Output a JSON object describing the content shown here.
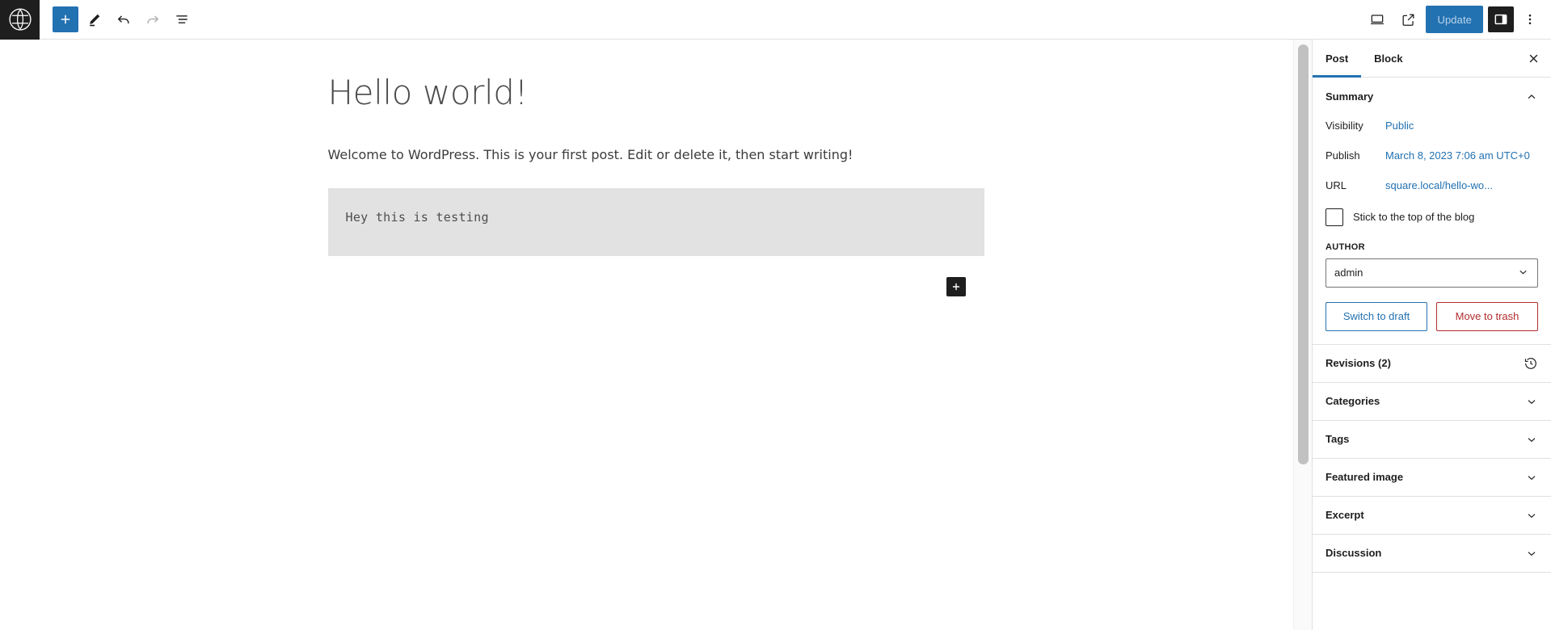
{
  "toolbar": {
    "logo_icon": "wordpress-logo-icon",
    "add_block_label": "+",
    "add_block_icon": "plus-icon",
    "tools_icon": "pencil-icon",
    "undo_icon": "undo-icon",
    "redo_icon": "redo-icon",
    "list_view_icon": "list-view-icon",
    "preview_icon": "desktop-preview-icon",
    "view_post_icon": "external-link-icon",
    "update_label": "Update",
    "settings_icon": "settings-sidebar-icon",
    "options_icon": "three-dots-vertical-icon",
    "accent_color": "#2271b1",
    "dark_color": "#1e1e1e"
  },
  "editor": {
    "title": "Hello world!",
    "paragraph": "Welcome to WordPress. This is your first post. Edit or delete it, then start writing!",
    "code_block": "Hey this is testing",
    "inserter_icon": "plus-icon"
  },
  "sidebar": {
    "tabs": [
      {
        "label": "Post",
        "active": true
      },
      {
        "label": "Block",
        "active": false
      }
    ],
    "close_icon": "close-icon",
    "summary": {
      "heading": "Summary",
      "chevron_icon": "chevron-up-icon",
      "rows": [
        {
          "label": "Visibility",
          "value": "Public"
        },
        {
          "label": "Publish",
          "value": "March 8, 2023 7:06 am UTC+0"
        },
        {
          "label": "URL",
          "value": "square.local/hello-wo..."
        }
      ],
      "sticky_label": "Stick to the top of the blog",
      "sticky_checked": false,
      "author_label": "AUTHOR",
      "author_value": "admin",
      "author_chevron_icon": "chevron-down-icon",
      "switch_draft_label": "Switch to draft",
      "move_trash_label": "Move to trash"
    },
    "revisions": {
      "label": "Revisions (2)",
      "icon": "revision-history-icon"
    },
    "panels": [
      {
        "label": "Categories",
        "chevron_icon": "chevron-down-icon"
      },
      {
        "label": "Tags",
        "chevron_icon": "chevron-down-icon"
      },
      {
        "label": "Featured image",
        "chevron_icon": "chevron-down-icon"
      },
      {
        "label": "Excerpt",
        "chevron_icon": "chevron-down-icon"
      },
      {
        "label": "Discussion",
        "chevron_icon": "chevron-down-icon"
      }
    ]
  }
}
